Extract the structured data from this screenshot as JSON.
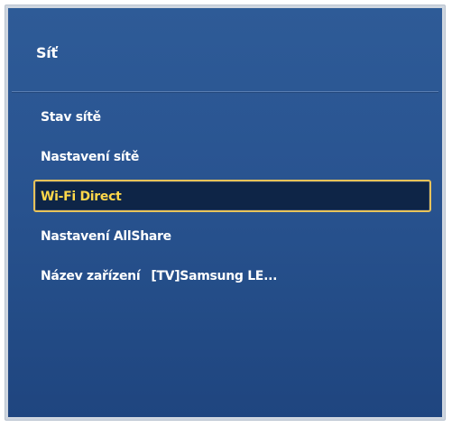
{
  "menu": {
    "title": "Síť",
    "items": [
      {
        "label": "Stav sítě"
      },
      {
        "label": "Nastavení sítě"
      },
      {
        "label": "Wi-Fi Direct"
      },
      {
        "label": "Nastavení AllShare"
      },
      {
        "label": "Název zařízení",
        "value": "[TV]Samsung LE..."
      }
    ],
    "selected_index": 2
  },
  "colors": {
    "panel_background": "#2a5592",
    "selected_background": "#0e2547",
    "selected_border": "#e8c35a",
    "selected_text": "#ffd84a",
    "text": "#ffffff"
  }
}
